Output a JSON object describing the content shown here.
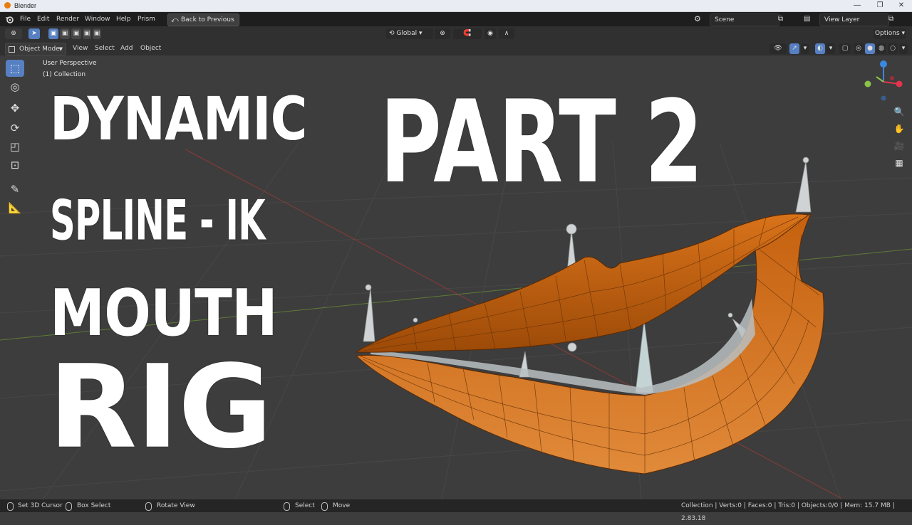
{
  "window": {
    "title": "Blender"
  },
  "menu": {
    "items": [
      "File",
      "Edit",
      "Render",
      "Window",
      "Help",
      "Prism"
    ],
    "back_button": "Back to Previous",
    "scene_field": "Scene",
    "view_layer_field": "View Layer"
  },
  "header": {
    "orientation": "Global",
    "options": "Options"
  },
  "viewport_header": {
    "mode": "Object Mode",
    "menus": [
      "View",
      "Select",
      "Add",
      "Object"
    ]
  },
  "viewport": {
    "perspective": "User Perspective",
    "collection": "(1) Collection"
  },
  "overlay_text": {
    "line1": "DYNAMIC",
    "line2": "SPLINE - IK",
    "line3": "MOUTH",
    "line4": "RIG",
    "part": "PART  2"
  },
  "status": {
    "left": [
      "Set 3D Cursor",
      "Box Select",
      "Rotate View",
      "Select",
      "Move"
    ],
    "right": "Collection | Verts:0 | Faces:0 | Tris:0 | Objects:0/0 | Mem: 15.7 MB | 2.83.18"
  },
  "colors": {
    "background": "#3d3d3d",
    "lips": "#c8640f",
    "active_tool": "#5680c2",
    "gizmo_x": "#e2344c",
    "gizmo_y": "#8bc34a",
    "gizmo_z": "#3c87e0"
  },
  "icons": {
    "tools": [
      "select-box-icon",
      "cursor-icon",
      "move-icon",
      "rotate-icon",
      "scale-icon",
      "transform-icon",
      "annotate-icon",
      "measure-icon"
    ],
    "navigation": [
      "zoom-icon",
      "hand-icon",
      "camera-icon",
      "grid-icon"
    ]
  }
}
